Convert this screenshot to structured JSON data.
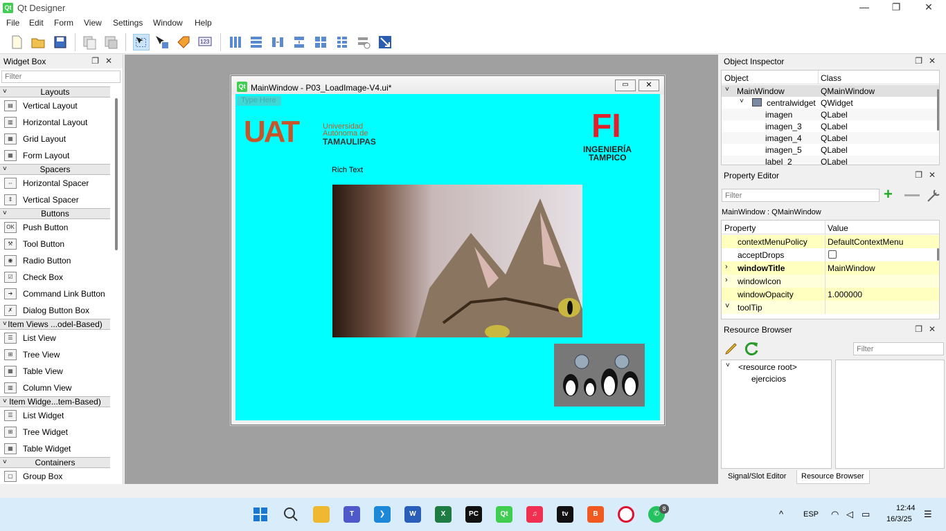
{
  "app": {
    "title": "Qt Designer",
    "logo_text": "Qt",
    "min": "—",
    "max": "❐",
    "close": "✕"
  },
  "menu": [
    "File",
    "Edit",
    "Form",
    "View",
    "Settings",
    "Window",
    "Help"
  ],
  "widget_box": {
    "title": "Widget Box",
    "filter_placeholder": "Filter",
    "categories": [
      {
        "label": "Layouts",
        "items": [
          "Vertical Layout",
          "Horizontal Layout",
          "Grid Layout",
          "Form Layout"
        ]
      },
      {
        "label": "Spacers",
        "items": [
          "Horizontal Spacer",
          "Vertical Spacer"
        ]
      },
      {
        "label": "Buttons",
        "items": [
          "Push Button",
          "Tool Button",
          "Radio Button",
          "Check Box",
          "Command Link Button",
          "Dialog Button Box"
        ]
      },
      {
        "label": "Item Views ...odel-Based)",
        "items": [
          "List View",
          "Tree View",
          "Table View",
          "Column View"
        ]
      },
      {
        "label": "Item Widge...tem-Based)",
        "items": [
          "List Widget",
          "Tree Widget",
          "Table Widget"
        ]
      },
      {
        "label": "Containers",
        "items": [
          "Group Box"
        ]
      }
    ]
  },
  "form": {
    "title": "MainWindow - P03_LoadImage-V4.ui*",
    "type_here": "Type Here",
    "rich_text": "Rich Text",
    "uat_letters": "UAT",
    "uat_line1": "Universidad",
    "uat_line2": "Autónoma de",
    "uat_line3": "TAMAULIPAS",
    "fi_letters": "FI",
    "fi_line1": "INGENIERÍA",
    "fi_line2": "TAMPICO"
  },
  "object_inspector": {
    "title": "Object Inspector",
    "col_object": "Object",
    "col_class": "Class",
    "rows": [
      {
        "name": "MainWindow",
        "cls": "QMainWindow"
      },
      {
        "name": "centralwidget",
        "cls": "QWidget"
      },
      {
        "name": "imagen",
        "cls": "QLabel"
      },
      {
        "name": "imagen_3",
        "cls": "QLabel"
      },
      {
        "name": "imagen_4",
        "cls": "QLabel"
      },
      {
        "name": "imagen_5",
        "cls": "QLabel"
      },
      {
        "name": "label_2",
        "cls": "QLabel"
      }
    ]
  },
  "property_editor": {
    "title": "Property Editor",
    "filter_placeholder": "Filter",
    "context": "MainWindow : QMainWindow",
    "col_property": "Property",
    "col_value": "Value",
    "rows": [
      {
        "prop": "contextMenuPolicy",
        "value": "DefaultContextMenu"
      },
      {
        "prop": "acceptDrops",
        "value": ""
      },
      {
        "prop": "windowTitle",
        "value": "MainWindow"
      },
      {
        "prop": "windowIcon",
        "value": ""
      },
      {
        "prop": "windowOpacity",
        "value": "1.000000"
      },
      {
        "prop": "toolTip",
        "value": ""
      }
    ]
  },
  "resource_browser": {
    "title": "Resource Browser",
    "filter_placeholder": "Filter",
    "root": "<resource root>",
    "child": "ejercicios",
    "tab_signal": "Signal/Slot Editor",
    "tab_resource": "Resource Browser"
  },
  "taskbar": {
    "lang": "ESP",
    "time": "12:44",
    "date": "16/3/25",
    "badge": "8"
  },
  "colors": {
    "form_bg": "#00ffff",
    "taskbar": "#d9ecfa",
    "prop_highlight": "#ffffc0"
  }
}
